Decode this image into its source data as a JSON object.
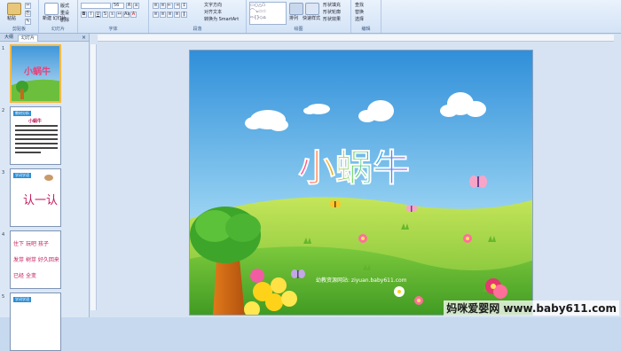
{
  "ribbon": {
    "groups": [
      {
        "label": "剪贴板"
      },
      {
        "label": "幻灯片"
      },
      {
        "label": "字体"
      },
      {
        "label": "段落"
      },
      {
        "label": "绘图"
      },
      {
        "label": "编辑"
      }
    ],
    "paste_label": "粘贴",
    "new_slide_label": "新建\n幻灯片",
    "layout_label": "版式",
    "reset_label": "重设",
    "delete_label": "删除",
    "font_size_value": "56",
    "text_direction_label": "文字方向",
    "align_text_label": "对齐文本",
    "smartart_label": "转换为 SmartArt",
    "arrange_label": "排列",
    "quick_styles_label": "快速样式",
    "shape_fill_label": "形状填充",
    "shape_outline_label": "形状轮廓",
    "shape_effects_label": "形状效果",
    "find_label": "查找",
    "replace_label": "替换",
    "select_label": "选择"
  },
  "panel": {
    "tab_outline": "大纲",
    "tab_slides": "幻灯片",
    "thumbs": [
      {
        "num": "1",
        "title": "小蜗牛"
      },
      {
        "num": "2",
        "badge": "教材分析",
        "heading": "小蜗牛"
      },
      {
        "num": "3",
        "badge": "学词学语",
        "text": "认一认"
      },
      {
        "num": "4",
        "rows": [
          [
            "住下",
            "玩吧",
            "孩子"
          ],
          [
            "发芽",
            "树芽",
            "好久",
            "回来"
          ],
          [
            "已经",
            "全变"
          ]
        ]
      },
      {
        "num": "5",
        "badge": "学词学语"
      }
    ]
  },
  "slide": {
    "title": "小蜗牛",
    "website": "幼教资源网站: ziyuan.baby611.com"
  },
  "watermark": "妈咪爱婴网 www.baby611.com"
}
